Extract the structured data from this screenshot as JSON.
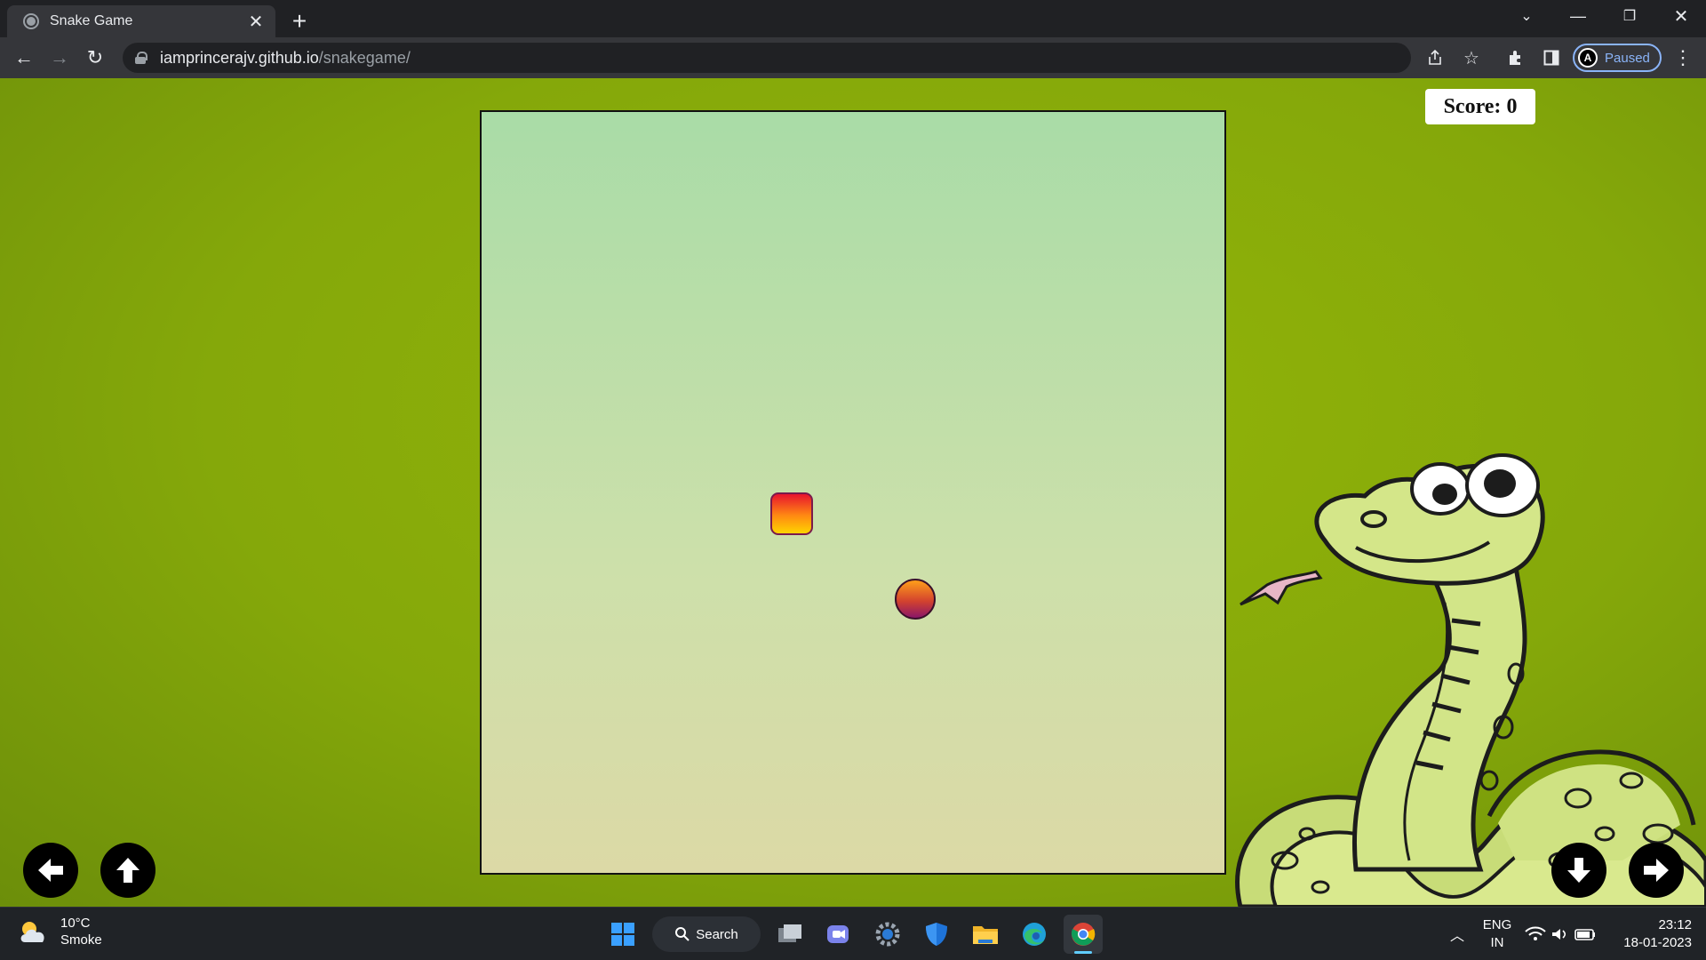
{
  "browser": {
    "tab_title": "Snake Game",
    "url_host": "iamprincerajv.github.io",
    "url_path": "/snakegame/",
    "profile_label": "Paused",
    "profile_initial": "A"
  },
  "game": {
    "score_label": "Score:",
    "score_value": "0",
    "head_color_top": "#e8142e",
    "head_color_bottom": "#ffd400",
    "food_color_top": "#ff9f1a",
    "food_color_bottom": "#8b1668",
    "controls": [
      "left-arrow",
      "up-arrow",
      "down-arrow",
      "right-arrow"
    ]
  },
  "taskbar": {
    "weather_temp": "10°C",
    "weather_desc": "Smoke",
    "search_label": "Search",
    "lang_top": "ENG",
    "lang_bottom": "IN",
    "time": "23:12",
    "date": "18-01-2023"
  },
  "colors": {
    "page_background": "#85a80a",
    "board_background": "#c5e0ab",
    "chrome_dark": "#202124"
  }
}
